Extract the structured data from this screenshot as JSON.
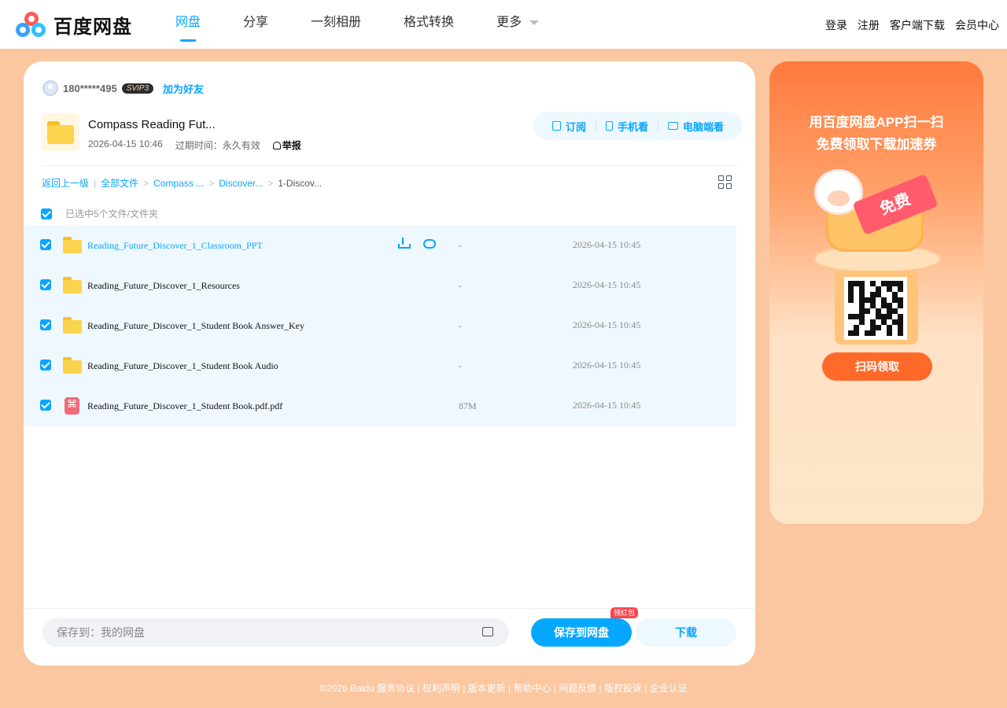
{
  "header": {
    "logo_text": "百度网盘",
    "nav": [
      {
        "label": "网盘",
        "active": true
      },
      {
        "label": "分享",
        "active": false
      },
      {
        "label": "一刻相册",
        "active": false
      },
      {
        "label": "格式转换",
        "active": false
      },
      {
        "label": "更多",
        "active": false
      }
    ],
    "right_links": [
      "登录",
      "注册",
      "客户端下载",
      "会员中心"
    ]
  },
  "share": {
    "user": "180*****495",
    "svip": "SVIP3",
    "add_friend": "加为好友",
    "title": "Compass Reading Fut...",
    "date": "2026-04-15 10:46",
    "expire": "过期时间：永久有效",
    "report": "举报",
    "actions": [
      "订阅",
      "手机看",
      "电脑端看"
    ]
  },
  "breadcrumb": {
    "back": "返回上一级",
    "all": "全部文件",
    "items": [
      "Compass ...",
      "Discover..."
    ],
    "current": "1-Discov..."
  },
  "selection_text": "已选中5个文件/文件夹",
  "files": [
    {
      "name": "Reading_Future_Discover_1_Classroom_PPT",
      "type": "folder",
      "size": "-",
      "time": "2026-04-15 10:45",
      "highlight": true
    },
    {
      "name": "Reading_Future_Discover_1_Resources",
      "type": "folder",
      "size": "-",
      "time": "2026-04-15 10:45",
      "highlight": false
    },
    {
      "name": "Reading_Future_Discover_1_Student Book Answer_Key",
      "type": "folder",
      "size": "-",
      "time": "2026-04-15 10:45",
      "highlight": false
    },
    {
      "name": "Reading_Future_Discover_1_Student Book Audio",
      "type": "folder",
      "size": "-",
      "time": "2026-04-15 10:45",
      "highlight": false
    },
    {
      "name": "Reading_Future_Discover_1_Student Book.pdf.pdf",
      "type": "pdf",
      "size": "87M",
      "time": "2026-04-15 10:45",
      "highlight": false
    }
  ],
  "bottom": {
    "save_to": "保存到：我的网盘",
    "save_button": "保存到网盘",
    "red_packet": "领红包",
    "download_button": "下载"
  },
  "ad": {
    "line1": "用百度网盘APP扫一扫",
    "line2": "免费领取下载加速券",
    "ticket": "免费",
    "button": "扫码领取"
  },
  "footer": "©2026 Baidu  服务协议 | 权利声明 | 版本更新 | 帮助中心 | 问题反馈 | 版权投诉 | 企业认证",
  "colors": {
    "accent": "#06a7ff",
    "background": "#fac7a0",
    "ad_orange": "#ff6a2b"
  }
}
